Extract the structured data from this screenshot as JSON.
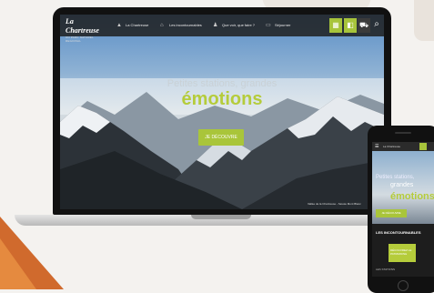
{
  "colors": {
    "accent": "#a9c53a",
    "orange": "#d06a2d",
    "nav_bg": "#1e1e1e"
  },
  "laptop": {
    "logo": {
      "main": "La Chartreuse",
      "sub": "UN PARC NATUREL REGIONAL"
    },
    "nav": [
      {
        "label": "La Chartreuse",
        "icon": "mountain-icon"
      },
      {
        "label": "Les incontournables",
        "icon": "landmark-icon"
      },
      {
        "label": "Que voir, que faire ?",
        "icon": "hiker-icon"
      },
      {
        "label": "Séjourner",
        "icon": "bed-icon"
      }
    ],
    "hero": {
      "line1": "Petites stations, grandes",
      "line2": "émotions",
      "button": "JE DÉCOUVRE"
    },
    "caption": "Vallée de la Chartreuse - Savoie Mont Blanc"
  },
  "phone": {
    "hero_line1": "Petites stations,",
    "hero_line2": "grandes",
    "hero_big": "émotions",
    "button": "JE DÉCOUVRE",
    "section_title": "LES INCONTOURNABLES",
    "card_text": "DÉCOUVREZ LE PATRIMOINE",
    "footer": "LES STATIONS"
  }
}
